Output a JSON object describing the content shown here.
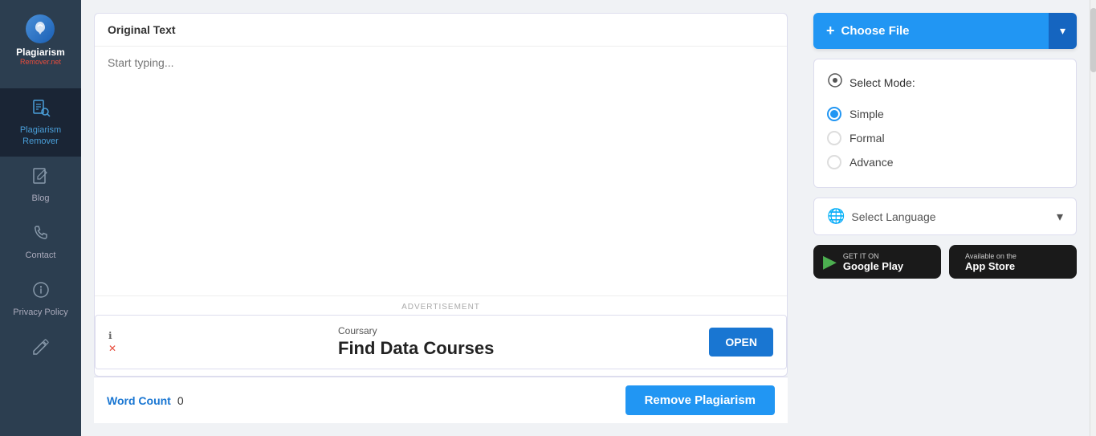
{
  "sidebar": {
    "logo": {
      "text": "Plagiarism",
      "subtext": "Remover.net",
      "icon": "🎵"
    },
    "items": [
      {
        "id": "plagiarism-remover",
        "label": "Plagiarism\nRemover",
        "icon": "📋",
        "active": true
      },
      {
        "id": "blog",
        "label": "Blog",
        "icon": "✏️",
        "active": false
      },
      {
        "id": "contact",
        "label": "Contact",
        "icon": "📞",
        "active": false
      },
      {
        "id": "privacy-policy",
        "label": "Privacy Policy",
        "icon": "ℹ️",
        "active": false
      },
      {
        "id": "more",
        "label": "",
        "icon": "✏️",
        "active": false
      }
    ]
  },
  "main": {
    "text_panel": {
      "header": "Original Text",
      "placeholder": "Start typing..."
    },
    "advertisement": {
      "label": "ADVERTISEMENT",
      "brand": "Coursary",
      "title": "Find Data Courses",
      "open_button": "OPEN"
    },
    "footer": {
      "word_count_label": "Word Count",
      "word_count_value": "0",
      "remove_button": "Remove Plagiarism"
    }
  },
  "right_panel": {
    "choose_file": {
      "label": "Choose File",
      "plus_icon": "+"
    },
    "mode_selector": {
      "header": "Select Mode:",
      "options": [
        {
          "id": "simple",
          "label": "Simple",
          "selected": true
        },
        {
          "id": "formal",
          "label": "Formal",
          "selected": false
        },
        {
          "id": "advance",
          "label": "Advance",
          "selected": false
        }
      ]
    },
    "language": {
      "placeholder": "Select Language"
    },
    "google_play": {
      "get": "GET IT ON",
      "store": "Google Play",
      "icon": "▶"
    },
    "app_store": {
      "get": "Available on the",
      "store": "App Store",
      "icon": ""
    }
  }
}
